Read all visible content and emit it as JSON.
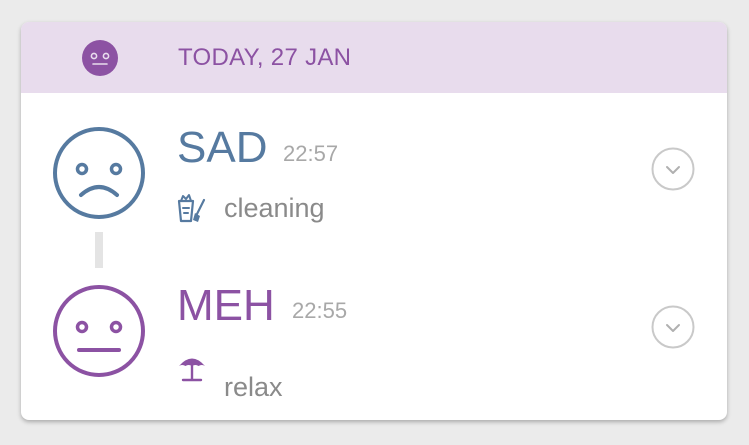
{
  "header": {
    "date_label": "TODAY, 27 JAN",
    "face_icon": "meh-face-icon"
  },
  "entries": [
    {
      "mood": "SAD",
      "time": "22:57",
      "color": "#567aa0",
      "face_icon": "sad-face-icon",
      "activity": {
        "label": "cleaning",
        "icon": "cleaning-icon"
      },
      "expand_icon": "chevron-down-icon"
    },
    {
      "mood": "MEH",
      "time": "22:55",
      "color": "#8c52a3",
      "face_icon": "meh-face-icon",
      "activity": {
        "label": "relax",
        "icon": "beach-umbrella-icon"
      },
      "expand_icon": "chevron-down-icon"
    }
  ],
  "colors": {
    "header_bg": "#e8dced",
    "accent": "#8c52a3",
    "sad": "#567aa0",
    "muted": "#a8a8a8"
  }
}
